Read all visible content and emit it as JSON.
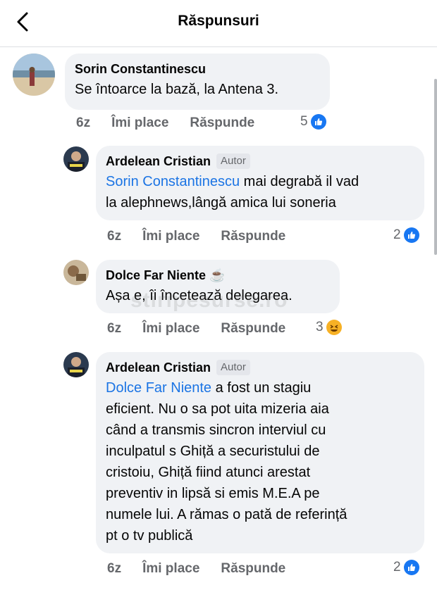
{
  "header": {
    "title": "Răspunsuri"
  },
  "watermark": "stiripesurse.ro",
  "comments": [
    {
      "author": "Sorin Constantinescu",
      "text": "Se întoarce la bază, la Antena 3.",
      "time": "6z",
      "like": "Îmi place",
      "reply": "Răspunde",
      "reactions": {
        "count": "5",
        "icon": "like-icon"
      }
    },
    {
      "author": "Ardelean Cristian",
      "tag": "Autor",
      "mention": "Sorin Constantinescu",
      "text_line1": " mai degrabă il vad",
      "text_line2": "la alephnews,lângă amica lui soneria",
      "time": "6z",
      "like": "Îmi place",
      "reply": "Răspunde",
      "reactions": {
        "count": "2",
        "icon": "like-icon"
      }
    },
    {
      "author": "Dolce Far Niente ☕",
      "text": "Așa e, îi încetează delegarea.",
      "time": "6z",
      "like": "Îmi place",
      "reply": "Răspunde",
      "reactions": {
        "count": "3",
        "icon": "haha-icon"
      }
    },
    {
      "author": "Ardelean Cristian",
      "tag": "Autor",
      "mention": "Dolce Far Niente",
      "lines": [
        " a fost un stagiu",
        "eficient. Nu o sa pot uita mizeria aia",
        "când a transmis sincron interviul cu",
        "inculpatul s Ghiță a securistului de",
        "cristoiu, Ghiță fiind atunci arestat",
        "preventiv in lipsă si emis M.E.A pe",
        "numele lui. A rămas o pată de referință",
        "pt o tv publică"
      ],
      "time": "6z",
      "like": "Îmi place",
      "reply": "Răspunde",
      "reactions": {
        "count": "2",
        "icon": "like-icon"
      }
    }
  ],
  "colors": {
    "mention": "#1b74e4",
    "like_blue": "#1877f2",
    "bubble": "#f0f2f5"
  }
}
